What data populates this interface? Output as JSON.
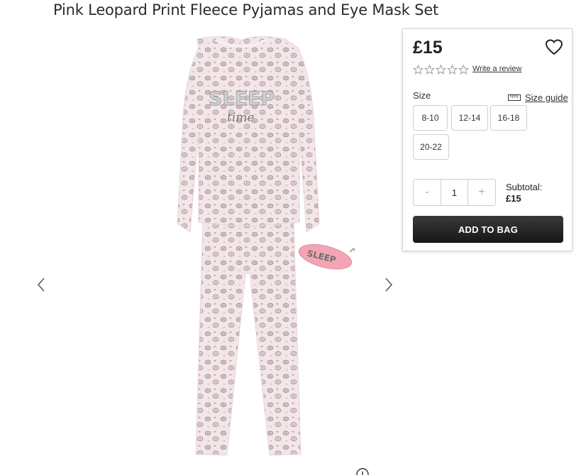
{
  "product": {
    "title": "Pink Leopard Print Fleece Pyjamas and Eye Mask Set",
    "image_graphic_text": "SLEEP",
    "image_graphic_script": "time",
    "mask_text": "SLEEP"
  },
  "gallery": {
    "prev_icon": "chevron-left-icon",
    "next_icon": "chevron-right-icon",
    "zoom_icon": "zoom-icon"
  },
  "purchase": {
    "price": "£15",
    "wishlist_icon": "heart-icon",
    "rating_stars": 0,
    "review_link": "Write a review",
    "size_label": "Size",
    "size_guide_label": "Size guide",
    "sizes": [
      "8-10",
      "12-14",
      "16-18",
      "20-22"
    ],
    "quantity": {
      "minus": "-",
      "value": "1",
      "plus": "+"
    },
    "subtotal_label": "Subtotal:",
    "subtotal_value": "£15",
    "add_to_bag_label": "ADD TO BAG"
  }
}
